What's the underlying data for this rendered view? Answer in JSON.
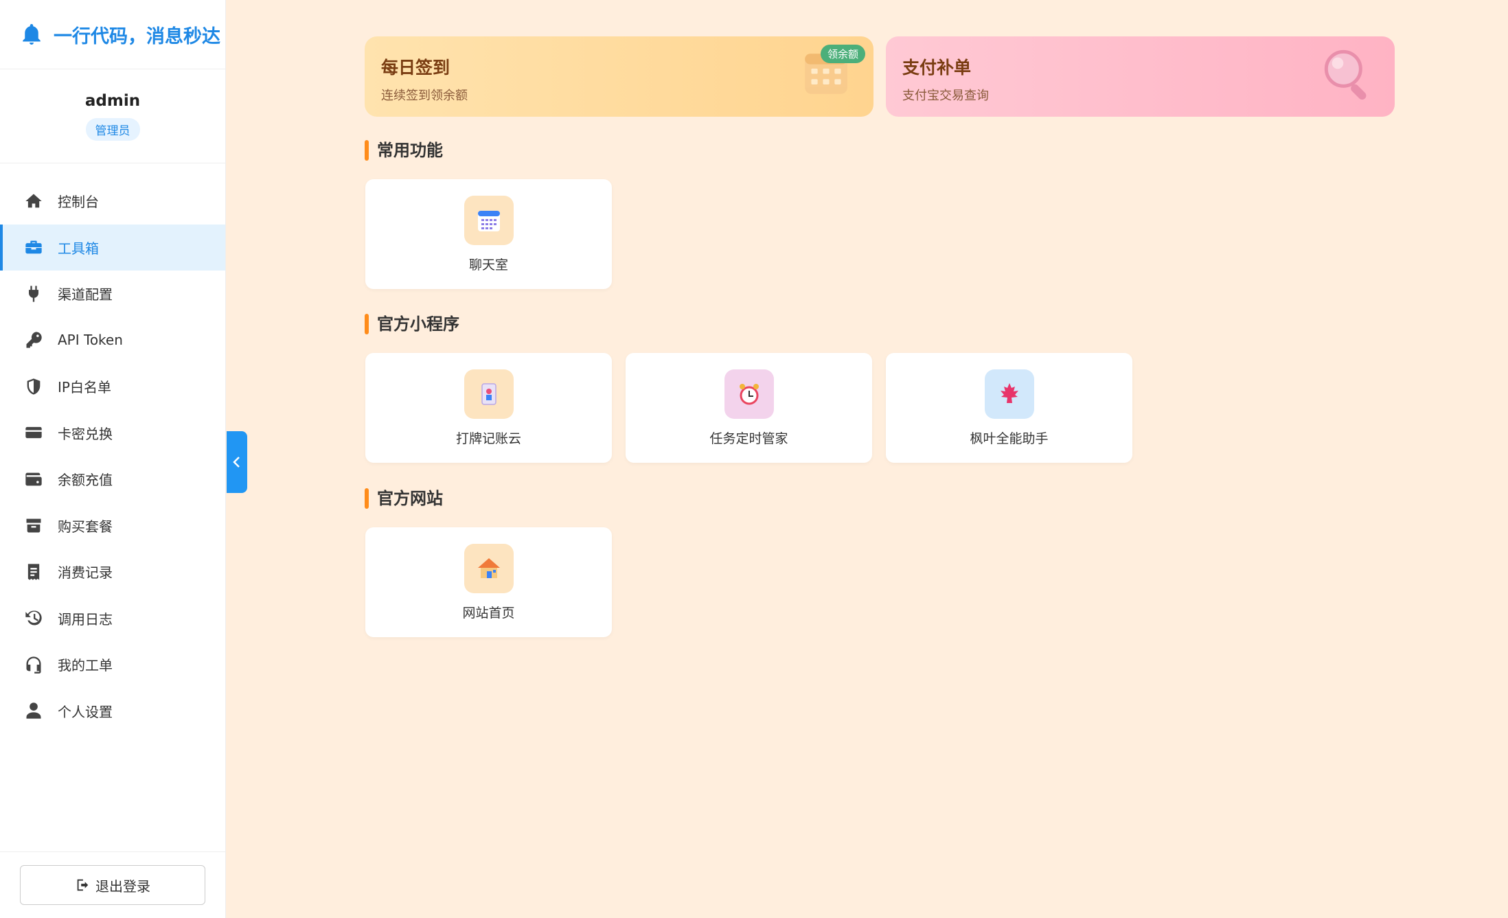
{
  "app": {
    "title": "一行代码，消息秒达"
  },
  "user": {
    "name": "admin",
    "role": "管理员"
  },
  "sidebar": {
    "items": [
      {
        "label": "控制台",
        "icon": "home-icon"
      },
      {
        "label": "工具箱",
        "icon": "toolbox-icon",
        "active": true
      },
      {
        "label": "渠道配置",
        "icon": "plug-icon"
      },
      {
        "label": "API Token",
        "icon": "key-icon"
      },
      {
        "label": "IP白名单",
        "icon": "shield-icon"
      },
      {
        "label": "卡密兑换",
        "icon": "card-icon"
      },
      {
        "label": "余额充值",
        "icon": "wallet-icon"
      },
      {
        "label": "购买套餐",
        "icon": "gift-box-icon"
      },
      {
        "label": "消费记录",
        "icon": "receipt-icon"
      },
      {
        "label": "调用日志",
        "icon": "history-icon"
      },
      {
        "label": "我的工单",
        "icon": "headset-icon"
      },
      {
        "label": "个人设置",
        "icon": "user-icon"
      }
    ],
    "logout_label": "退出登录"
  },
  "banners": {
    "sign": {
      "title": "每日签到",
      "subtitle": "连续签到领余额",
      "badge": "领余额"
    },
    "pay": {
      "title": "支付补单",
      "subtitle": "支付宝交易查询"
    }
  },
  "sections": {
    "common": {
      "title": "常用功能",
      "items": [
        {
          "label": "聊天室",
          "icon": "calendar-icon"
        }
      ]
    },
    "mini": {
      "title": "官方小程序",
      "items": [
        {
          "label": "打牌记账云",
          "icon": "playing-card-icon"
        },
        {
          "label": "任务定时管家",
          "icon": "alarm-clock-icon"
        },
        {
          "label": "枫叶全能助手",
          "icon": "maple-leaf-icon"
        }
      ]
    },
    "web": {
      "title": "官方网站",
      "items": [
        {
          "label": "网站首页",
          "icon": "house-icon"
        }
      ]
    }
  },
  "colors": {
    "accent": "#1e88e5",
    "section_bar": "#ff8c1a",
    "background": "#ffeedd"
  }
}
